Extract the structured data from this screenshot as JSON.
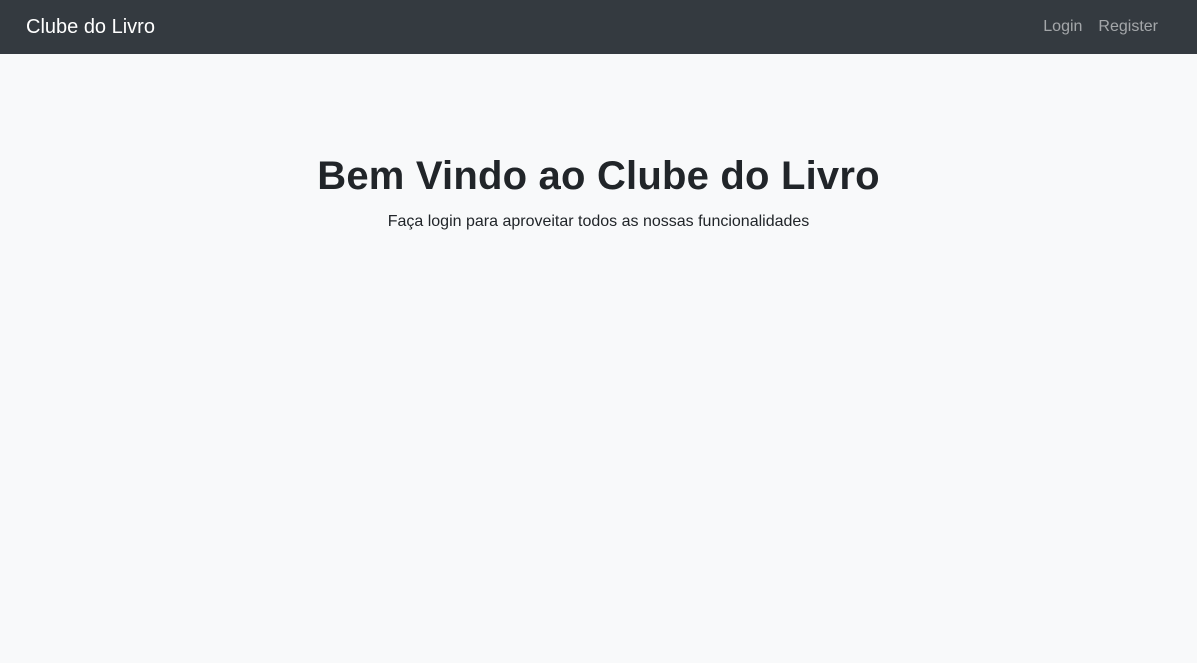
{
  "navbar": {
    "brand": "Clube do Livro",
    "links": [
      {
        "label": "Login"
      },
      {
        "label": "Register"
      }
    ]
  },
  "hero": {
    "title": "Bem Vindo ao Clube do Livro",
    "subtitle": "Faça login para aproveitar todos as nossas funcionalidades"
  },
  "colors": {
    "navbar_bg": "#343a40",
    "page_bg": "#f8f9fa",
    "text": "#212529"
  }
}
